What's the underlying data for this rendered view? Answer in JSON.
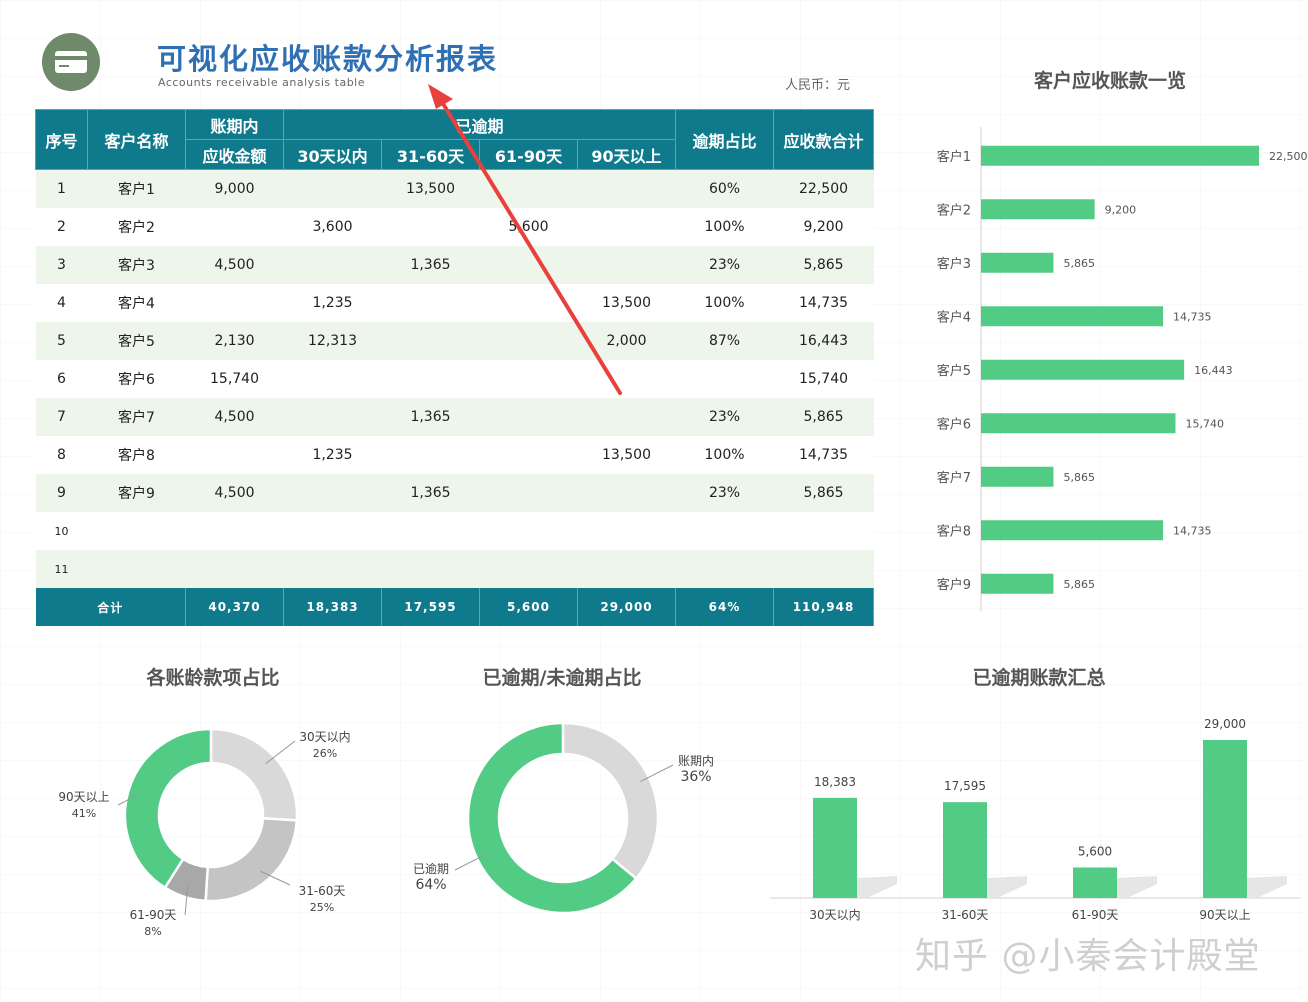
{
  "header": {
    "title": "可视化应收账款分析报表",
    "subtitle": "Accounts receivable analysis table",
    "currency": "人民币：元"
  },
  "table": {
    "headers": {
      "index": "序号",
      "name": "客户名称",
      "in_term_top": "账期内",
      "in_term_bottom": "应收金额",
      "overdue_group": "已逾期",
      "b30": "30天以内",
      "b60": "31-60天",
      "b90": "61-90天",
      "b90p": "90天以上",
      "ratio": "逾期占比",
      "total": "应收款合计"
    },
    "rows": [
      {
        "idx": "1",
        "name": "客户1",
        "in_term": "9,000",
        "b30": "",
        "b60": "13,500",
        "b90": "",
        "b90p": "",
        "ratio": "60%",
        "total": "22,500"
      },
      {
        "idx": "2",
        "name": "客户2",
        "in_term": "",
        "b30": "3,600",
        "b60": "",
        "b90": "5,600",
        "b90p": "",
        "ratio": "100%",
        "total": "9,200"
      },
      {
        "idx": "3",
        "name": "客户3",
        "in_term": "4,500",
        "b30": "",
        "b60": "1,365",
        "b90": "",
        "b90p": "",
        "ratio": "23%",
        "total": "5,865"
      },
      {
        "idx": "4",
        "name": "客户4",
        "in_term": "",
        "b30": "1,235",
        "b60": "",
        "b90": "",
        "b90p": "13,500",
        "ratio": "100%",
        "total": "14,735"
      },
      {
        "idx": "5",
        "name": "客户5",
        "in_term": "2,130",
        "b30": "12,313",
        "b60": "",
        "b90": "",
        "b90p": "2,000",
        "ratio": "87%",
        "total": "16,443"
      },
      {
        "idx": "6",
        "name": "客户6",
        "in_term": "15,740",
        "b30": "",
        "b60": "",
        "b90": "",
        "b90p": "",
        "ratio": "",
        "total": "15,740"
      },
      {
        "idx": "7",
        "name": "客户7",
        "in_term": "4,500",
        "b30": "",
        "b60": "1,365",
        "b90": "",
        "b90p": "",
        "ratio": "23%",
        "total": "5,865"
      },
      {
        "idx": "8",
        "name": "客户8",
        "in_term": "",
        "b30": "1,235",
        "b60": "",
        "b90": "",
        "b90p": "13,500",
        "ratio": "100%",
        "total": "14,735"
      },
      {
        "idx": "9",
        "name": "客户9",
        "in_term": "4,500",
        "b30": "",
        "b60": "1,365",
        "b90": "",
        "b90p": "",
        "ratio": "23%",
        "total": "5,865"
      },
      {
        "idx": "10",
        "name": "",
        "in_term": "",
        "b30": "",
        "b60": "",
        "b90": "",
        "b90p": "",
        "ratio": "",
        "total": ""
      },
      {
        "idx": "11",
        "name": "",
        "in_term": "",
        "b30": "",
        "b60": "",
        "b90": "",
        "b90p": "",
        "ratio": "",
        "total": ""
      }
    ],
    "footer": {
      "label": "合计",
      "in_term": "40,370",
      "b30": "18,383",
      "b60": "17,595",
      "b90": "5,600",
      "b90p": "29,000",
      "ratio": "64%",
      "total": "110,948"
    }
  },
  "colors": {
    "green": "#52cc85",
    "teal_header": "#0e7a8c",
    "row_tint": "#eef6ec",
    "title_blue": "#2f6fb4",
    "arrow_red": "#e8403c",
    "grey_light": "#d9d9d9",
    "grey_mid": "#c4c4c4",
    "grey_dark": "#a8a8a8"
  },
  "chart_data": [
    {
      "type": "bar",
      "orientation": "horizontal",
      "title": "客户应收账款一览",
      "categories": [
        "客户1",
        "客户2",
        "客户3",
        "客户4",
        "客户5",
        "客户6",
        "客户7",
        "客户8",
        "客户9"
      ],
      "values": [
        22500,
        9200,
        5865,
        14735,
        16443,
        15740,
        5865,
        14735,
        5865
      ],
      "value_labels": [
        "22,500",
        "9,200",
        "5,865",
        "14,735",
        "16,443",
        "15,740",
        "5,865",
        "14,735",
        "5,865"
      ],
      "xlim": [
        0,
        22500
      ],
      "grid": false
    },
    {
      "type": "pie",
      "style": "donut",
      "title": "各账龄款项占比",
      "slices": [
        {
          "label": "30天以内",
          "pct": "26%",
          "value": 26,
          "color": "#d9d9d9"
        },
        {
          "label": "31-60天",
          "pct": "25%",
          "value": 25,
          "color": "#c4c4c4"
        },
        {
          "label": "61-90天",
          "pct": "8%",
          "value": 8,
          "color": "#a8a8a8"
        },
        {
          "label": "90天以上",
          "pct": "41%",
          "value": 41,
          "color": "#52cc85"
        }
      ]
    },
    {
      "type": "pie",
      "style": "donut",
      "title": "已逾期/未逾期占比",
      "slices": [
        {
          "label": "账期内",
          "pct": "36%",
          "value": 36,
          "color": "#d9d9d9"
        },
        {
          "label": "已逾期",
          "pct": "64%",
          "value": 64,
          "color": "#52cc85"
        }
      ]
    },
    {
      "type": "bar",
      "title": "已逾期账款汇总",
      "categories": [
        "30天以内",
        "31-60天",
        "61-90天",
        "90天以上"
      ],
      "values": [
        18383,
        17595,
        5600,
        29000
      ],
      "value_labels": [
        "18,383",
        "17,595",
        "5,600",
        "29,000"
      ],
      "ylim": [
        0,
        29000
      ],
      "grid": false
    }
  ],
  "watermark": "知乎 @小秦会计殿堂"
}
